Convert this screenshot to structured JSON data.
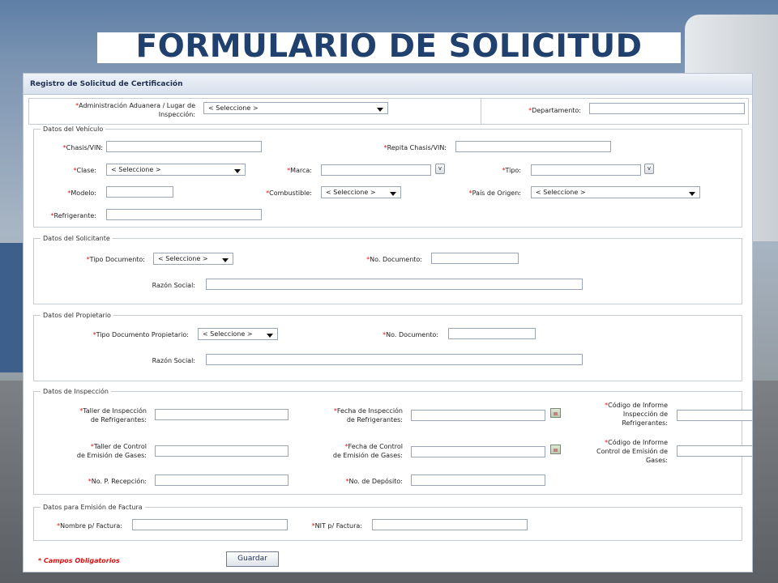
{
  "page_title": "FORMULARIO DE SOLICITUD",
  "form": {
    "header": "Registro de Solicitud de Certificación",
    "top": {
      "aduana_label_1": "Administración Aduanera / Lugar de",
      "aduana_label_2": "Inspección:",
      "aduana_value": "< Seleccione >",
      "departamento_label": "Departamento:"
    },
    "vehiculo": {
      "legend": "Datos del Vehículo",
      "chasis_label": "Chasis/VIN:",
      "repita_chasis_label": "Repita Chasis/VIN:",
      "clase_label": "Clase:",
      "clase_value": "< Seleccione >",
      "marca_label": "Marca:",
      "tipo_label": "Tipo:",
      "modelo_label": "Modelo:",
      "combustible_label": "Combustible:",
      "combustible_value": "< Seleccione >",
      "pais_label": "País de Origen:",
      "pais_value": "< Seleccione >",
      "refrigerante_label": "Refrigerante:",
      "v_button": "v"
    },
    "solicitante": {
      "legend": "Datos del Solicitante",
      "tipo_doc_label": "Tipo Documento:",
      "tipo_doc_value": "< Seleccione >",
      "no_doc_label": "No. Documento:",
      "razon_label": "Razón Social:"
    },
    "propietario": {
      "legend": "Datos del Propietario",
      "tipo_doc_label": "Tipo Documento Propietario:",
      "tipo_doc_value": "< Seleccione >",
      "no_doc_label": "No. Documento:",
      "razon_label": "Razón Social:"
    },
    "inspeccion": {
      "legend": "Datos de Inspección",
      "taller_ref_1": "Taller de Inspección",
      "taller_ref_2": "de Refrigerantes:",
      "fecha_ref_1": "Fecha de Inspección",
      "fecha_ref_2": "de Refrigerantes:",
      "codigo_ref_1": "Código de Informe",
      "codigo_ref_2": "Inspección de",
      "codigo_ref_3": "Refrigerantes:",
      "taller_gas_1": "Taller de Control",
      "taller_gas_2": "de Emisión de Gases:",
      "fecha_gas_1": "Fecha de Control",
      "fecha_gas_2": "de Emisión de Gases:",
      "codigo_gas_1": "Código de Informe",
      "codigo_gas_2": "Control de Emisión de",
      "codigo_gas_3": "Gases:",
      "recepcion_label": "No. P. Recepción:",
      "deposito_label": "No. de Depósito:"
    },
    "factura": {
      "legend": "Datos para Emisión de Factura",
      "nombre_label": "Nombre p/ Factura:",
      "nit_label": "NIT p/ Factura:"
    },
    "required_note": "* Campos Obligatorios",
    "save_button": "Guardar"
  }
}
